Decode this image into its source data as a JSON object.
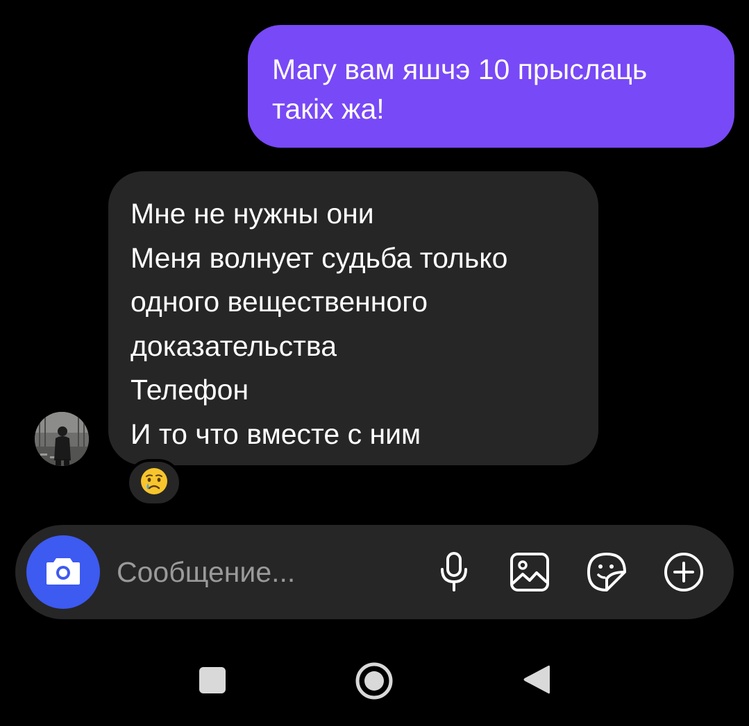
{
  "chat": {
    "outgoing": {
      "lines": [
        "Магу вам яшчэ 10 прыслаць",
        "такіх жа!"
      ]
    },
    "incoming": {
      "lines": [
        "Мне не нужны они",
        "Меня волнует судьба только",
        "одного вещественного",
        "доказательства",
        "Телефон",
        "И то что вместе с ним"
      ],
      "reaction": "😢"
    }
  },
  "composer": {
    "placeholder": "Сообщение...",
    "value": "",
    "icons": [
      "camera-icon",
      "microphone-icon",
      "gallery-icon",
      "sticker-icon",
      "plus-icon"
    ]
  },
  "navbar": {
    "icons": [
      "recents-square-icon",
      "home-circle-icon",
      "back-triangle-icon"
    ]
  },
  "colors": {
    "background": "#000000",
    "outgoing_bubble": "#7849f6",
    "incoming_bubble": "#262626",
    "composer": "#262626",
    "camera_button": "#3d5af1",
    "placeholder_text": "#9a9a9a",
    "nav_icons": "#d9d9d9"
  }
}
